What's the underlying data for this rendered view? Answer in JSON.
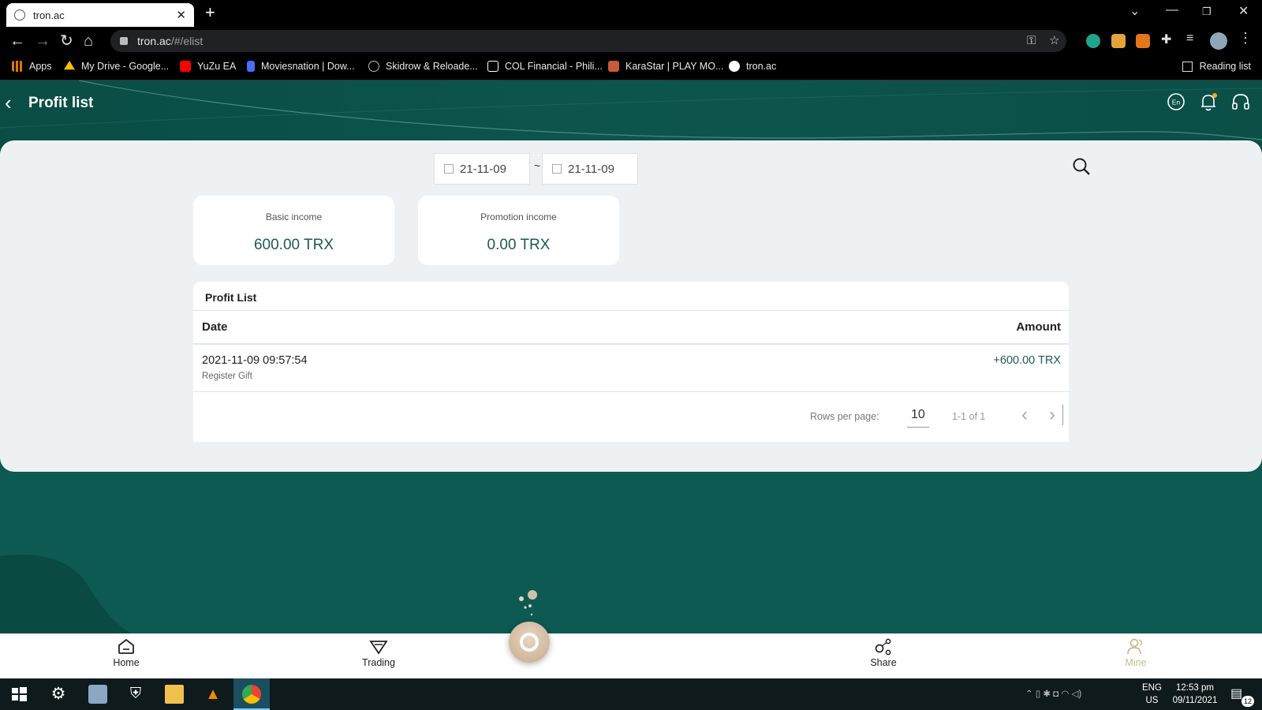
{
  "browser": {
    "tab_title": "tron.ac",
    "url_host": "tron.ac",
    "url_path": "/#/elist",
    "bookmarks": [
      {
        "label": "Apps",
        "icon": "apps-grid-icon",
        "color": "#e37400"
      },
      {
        "label": "My Drive - Google...",
        "icon": "google-drive-icon",
        "color": "#fbbc04"
      },
      {
        "label": "YuZu EA",
        "icon": "youtube-icon",
        "color": "#ff0000"
      },
      {
        "label": "Moviesnation | Dow...",
        "icon": "m-logo-icon",
        "color": "#4a6cf7"
      },
      {
        "label": "Skidrow & Reloade...",
        "icon": "globe-icon",
        "color": "#888888"
      },
      {
        "label": "COL Financial - Phili...",
        "icon": "col-logo-icon",
        "color": "#ffffff"
      },
      {
        "label": "KaraStar | PLAY MO...",
        "icon": "karastar-icon",
        "color": "#c65a3a"
      },
      {
        "label": "tron.ac",
        "icon": "globe-icon",
        "color": "#ffffff"
      }
    ],
    "reading_list": "Reading list"
  },
  "header": {
    "title": "Profit list",
    "icons": [
      "language-en-icon",
      "bell-icon",
      "headset-icon"
    ],
    "language_badge": "En"
  },
  "filters": {
    "start_date": "21-11-09",
    "end_date": "21-11-09",
    "separator": "~"
  },
  "incomes": {
    "basic_label": "Basic income",
    "basic_value": "600.00 TRX",
    "promotion_label": "Promotion income",
    "promotion_value": "0.00 TRX"
  },
  "profit_list": {
    "title": "Profit List",
    "columns": {
      "date": "Date",
      "amount": "Amount"
    },
    "rows": [
      {
        "date": "2021-11-09 09:57:54",
        "type": "Register Gift",
        "amount": "+600.00 TRX"
      }
    ],
    "pagination": {
      "rows_per_page_label": "Rows per page:",
      "rows_per_page": "10",
      "range": "1-1 of 1"
    }
  },
  "bottom_nav": {
    "home": "Home",
    "trading": "Trading",
    "share": "Share",
    "mine": "Mine"
  },
  "taskbar": {
    "lang_top": "ENG",
    "lang_bottom": "US",
    "time": "12:53 pm",
    "date": "09/11/2021",
    "notifications": "12"
  },
  "colors": {
    "brand_teal": "#0d5a52",
    "accent_text": "#1d5a55",
    "mine_gold": "#c9b98d"
  }
}
